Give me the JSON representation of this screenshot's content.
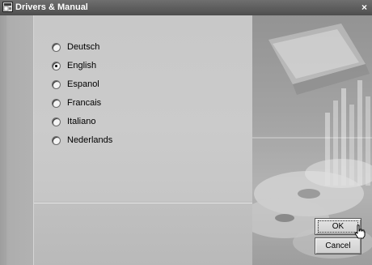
{
  "window": {
    "title": "Drivers & Manual",
    "close_label": "×"
  },
  "languages": {
    "selected": "English",
    "options": [
      {
        "label": "Deutsch",
        "checked": false
      },
      {
        "label": "English",
        "checked": true
      },
      {
        "label": "Espanol",
        "checked": false
      },
      {
        "label": "Francais",
        "checked": false
      },
      {
        "label": "Italiano",
        "checked": false
      },
      {
        "label": "Nederlands",
        "checked": false
      }
    ]
  },
  "buttons": {
    "ok_label": "OK",
    "cancel_label": "Cancel"
  },
  "icons": {
    "app": "app-window-icon",
    "close": "close-icon",
    "cursor": "hand-pointer-icon"
  }
}
